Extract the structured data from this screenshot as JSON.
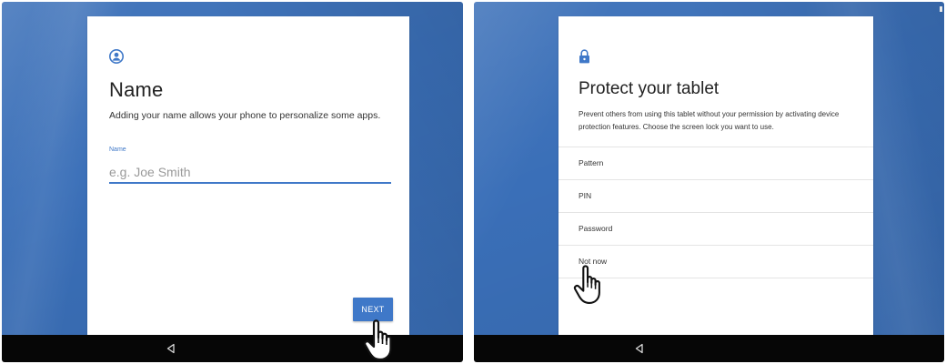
{
  "name_screen": {
    "icon": "person-icon",
    "title": "Name",
    "description": "Adding your name allows your phone to personalize some apps.",
    "field_label": "Name",
    "field_placeholder": "e.g. Joe Smith",
    "field_value": "",
    "next_label": "NEXT",
    "nav_icon": "back-triangle-icon"
  },
  "protect_screen": {
    "icon": "lock-icon",
    "title": "Protect your tablet",
    "description": "Prevent others from using this tablet without your permission by activating device protection features. Choose the screen lock you want to use.",
    "options": [
      {
        "label": "Pattern"
      },
      {
        "label": "PIN"
      },
      {
        "label": "Password"
      },
      {
        "label": "Not now"
      }
    ],
    "nav_icon": "back-triangle-icon"
  },
  "colors": {
    "accent": "#3f78c8",
    "background": "#3a6fb8",
    "navbar": "#060606",
    "card": "#ffffff"
  }
}
